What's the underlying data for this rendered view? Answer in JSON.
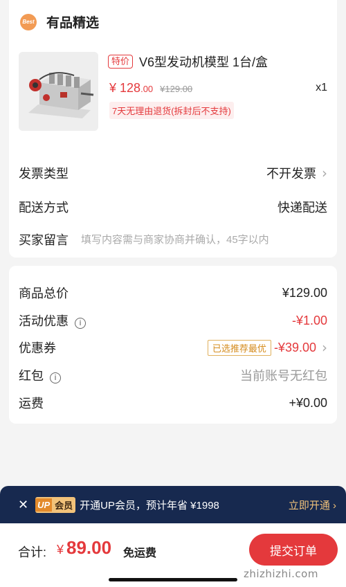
{
  "store": {
    "logo_text": "Best",
    "name": "有品精选"
  },
  "product": {
    "image_icon": "engine-model-image",
    "special_tag": "特价",
    "title": "V6型发动机模型 1台/盒",
    "price_currency": "¥",
    "price_int": "128",
    "price_dec": ".00",
    "price_original": "¥129.00",
    "quantity": "x1",
    "return_policy": "7天无理由退货(拆封后不支持)"
  },
  "options": {
    "invoice_label": "发票类型",
    "invoice_value": "不开发票",
    "delivery_label": "配送方式",
    "delivery_value": "快递配送",
    "remark_label": "买家留言",
    "remark_placeholder": "填写内容需与商家协商并确认，45字以内"
  },
  "summary": {
    "goods_total_label": "商品总价",
    "goods_total_value": "¥129.00",
    "promo_label": "活动优惠",
    "promo_value": "-¥1.00",
    "coupon_label": "优惠券",
    "coupon_tag": "已选推荐最优",
    "coupon_value": "-¥39.00",
    "redpacket_label": "红包",
    "redpacket_value": "当前账号无红包",
    "shipping_label": "运费",
    "shipping_value": "+¥0.00"
  },
  "vip": {
    "badge_up": "UP",
    "badge_vip": "会员",
    "text": "开通UP会员，预计年省 ¥1998",
    "open_label": "立即开通 ›"
  },
  "checkout": {
    "total_label": "合计:",
    "currency": "¥",
    "total_value": "89.00",
    "free_shipping": "免运费",
    "submit_label": "提交订单"
  },
  "watermark": "zhizhizhi.com",
  "colors": {
    "accent": "#e4393c",
    "vip_bg": "#17294f",
    "vip_gold": "#f1c27a",
    "store_logo": "#f29b54"
  }
}
